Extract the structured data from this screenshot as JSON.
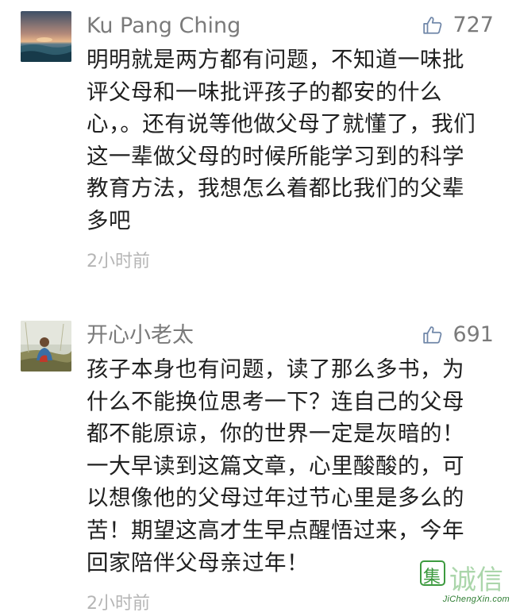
{
  "comments": [
    {
      "username": "Ku Pang Ching",
      "likes": "727",
      "text": "明明就是两方都有问题，不知道一味批评父母和一味批评孩子的都安的什么心，。还有说等他做父母了就懂了，我们这一辈做父母的时候所能学习到的科学教育方法，我想怎么着都比我们的父辈多吧",
      "time": "2小时前",
      "avatar_icon": "sunset-sea-avatar"
    },
    {
      "username": "开心小老太",
      "likes": "691",
      "text": "孩子本身也有问题，读了那么多书，为什么不能换位思考一下？连自己的父母都不能原谅，你的世界一定是灰暗的！一大早读到这篇文章，心里酸酸的，可以想像他的父母过年过节心里是多么的苦！期望这高才生早点醒悟过来，今年回家陪伴父母亲过年！",
      "time": "2小时前",
      "avatar_icon": "woman-outdoor-avatar"
    }
  ],
  "watermark": {
    "logo_char": "集",
    "logo_text": "诚信",
    "site": "JiChengXin.com"
  },
  "colors": {
    "username": "#7a7a7a",
    "body": "#202020",
    "time": "#b5b5b5",
    "like_icon": "#6f86a8",
    "watermark": "#2e7d32"
  }
}
